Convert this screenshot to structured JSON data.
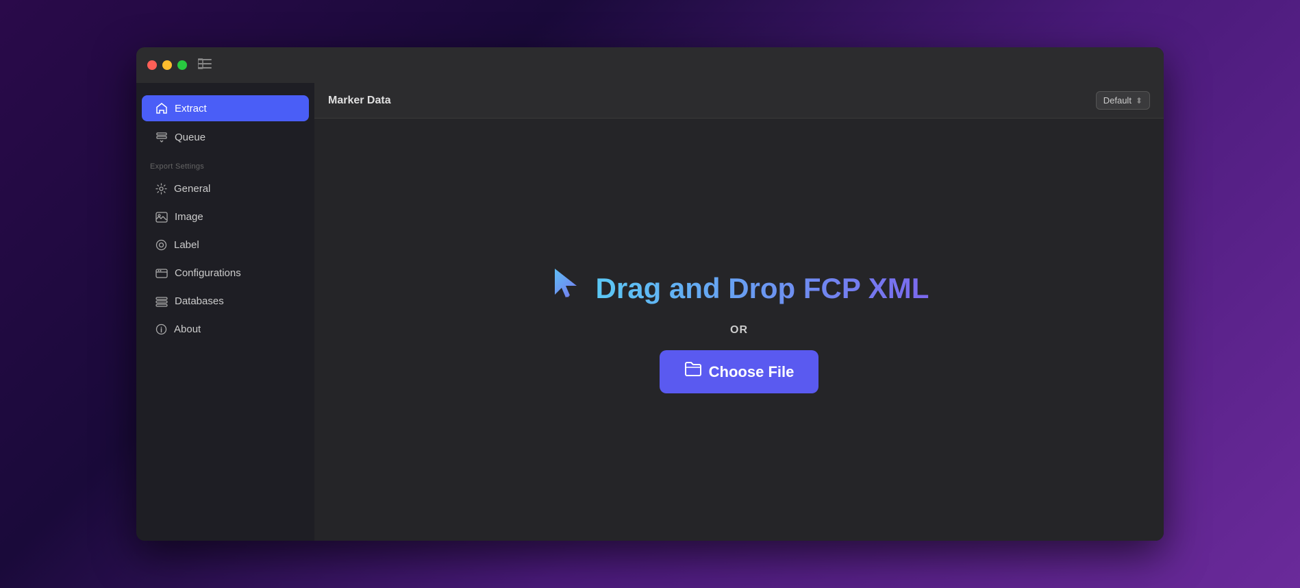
{
  "window": {
    "title": "Marker Data"
  },
  "window_controls": {
    "close_label": "",
    "minimize_label": "",
    "maximize_label": ""
  },
  "sidebar": {
    "items": [
      {
        "id": "extract",
        "label": "Extract",
        "icon": "⌂",
        "active": true
      },
      {
        "id": "queue",
        "label": "Queue",
        "icon": "⬇",
        "active": false
      }
    ],
    "section_label": "Export Settings",
    "settings_items": [
      {
        "id": "general",
        "label": "General",
        "icon": "⚙"
      },
      {
        "id": "image",
        "label": "Image",
        "icon": "🖼"
      },
      {
        "id": "label",
        "label": "Label",
        "icon": "◎"
      },
      {
        "id": "configurations",
        "label": "Configurations",
        "icon": "💼"
      },
      {
        "id": "databases",
        "label": "Databases",
        "icon": "🗃"
      },
      {
        "id": "about",
        "label": "About",
        "icon": "ℹ"
      }
    ]
  },
  "header": {
    "title": "Marker Data",
    "dropdown_label": "Default"
  },
  "main": {
    "drag_drop_text": "Drag and Drop FCP XML",
    "or_text": "OR",
    "choose_file_label": "Choose File"
  }
}
